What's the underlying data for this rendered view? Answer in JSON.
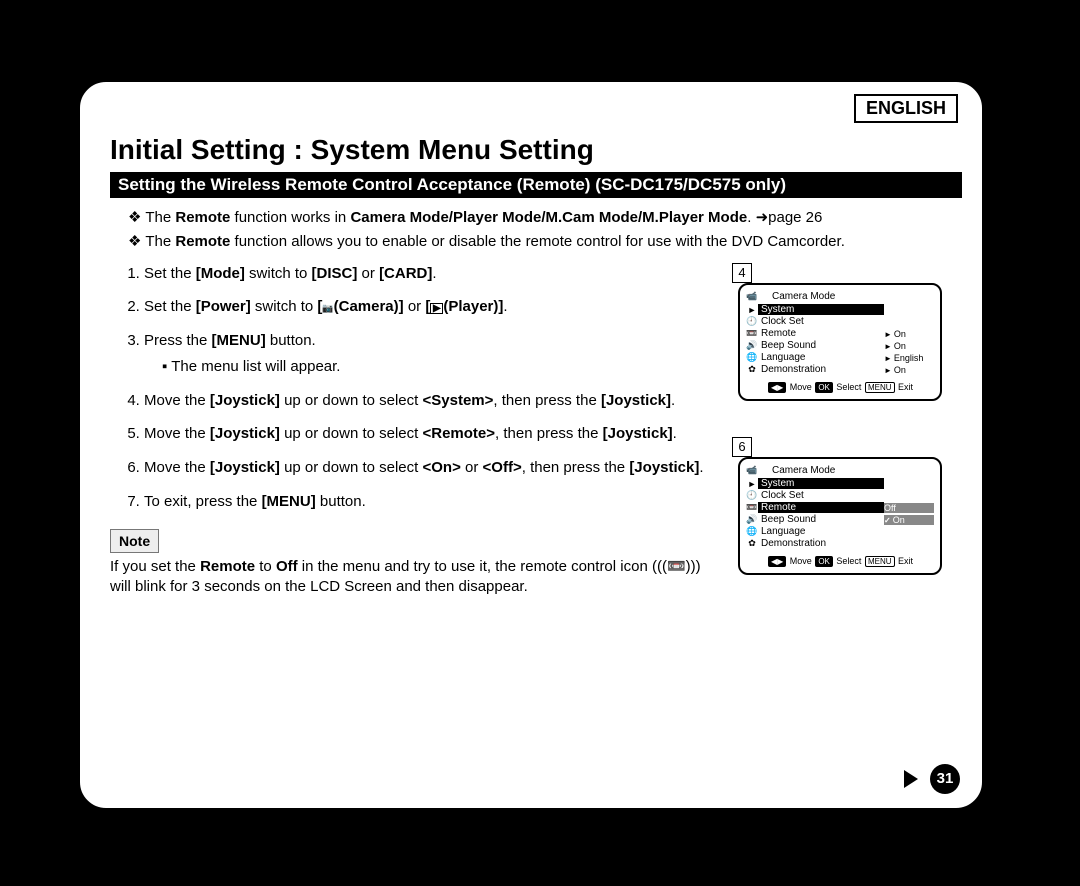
{
  "language_label": "ENGLISH",
  "title": "Initial Setting : System Menu Setting",
  "band": "Setting the Wireless Remote Control Acceptance (Remote) (SC-DC175/DC575 only)",
  "intro": {
    "l1a": "The ",
    "l1b": "Remote",
    "l1c": " function works in ",
    "l1d": "Camera Mode/Player Mode/M.Cam Mode/M.Player Mode",
    "l1e": ". ",
    "l1f": "page 26",
    "l2a": "The ",
    "l2b": "Remote",
    "l2c": " function allows you to enable or disable the remote control for use with the DVD Camcorder."
  },
  "steps": {
    "s1": {
      "a": "Set the ",
      "b": "[Mode]",
      "c": " switch to ",
      "d": "[DISC]",
      "e": " or ",
      "f": "[CARD]",
      "g": "."
    },
    "s2": {
      "a": "Set the ",
      "b": "[Power]",
      "c": " switch to ",
      "d": "[",
      "e": "(Camera)]",
      "f": " or ",
      "g": "[",
      "h": "(Player)]",
      "i": "."
    },
    "s3": {
      "a": "Press the ",
      "b": "[MENU]",
      "c": " button."
    },
    "s3sub": "The menu list will appear.",
    "s4": {
      "a": "Move the ",
      "b": "[Joystick]",
      "c": " up or down to select ",
      "d": "<System>",
      "e": ", then press the ",
      "f": "[Joystick]",
      "g": "."
    },
    "s5": {
      "a": "Move the ",
      "b": "[Joystick]",
      "c": " up or down to select ",
      "d": "<Remote>",
      "e": ", then press the ",
      "f": "[Joystick]",
      "g": "."
    },
    "s6": {
      "a": "Move the ",
      "b": "[Joystick]",
      "c": " up or down to select ",
      "d": "<On>",
      "e": " or ",
      "f": "<Off>",
      "g": ", then press the ",
      "h": "[Joystick]",
      "i": "."
    },
    "s7": {
      "a": "To exit, press the ",
      "b": "[MENU]",
      "c": " button."
    }
  },
  "note_label": "Note",
  "note": {
    "a": "If you set the ",
    "b": "Remote",
    "c": " to ",
    "d": "Off",
    "e": " in the menu and try to use it, the remote control icon (",
    "f": ") will blink for 3 seconds on the LCD Screen and then disappear."
  },
  "screens": {
    "s4": {
      "num": "4",
      "title": "Camera Mode",
      "rows": [
        {
          "icon": "►",
          "name": "System",
          "val": "",
          "hl": "hl"
        },
        {
          "icon": "🕘",
          "name": "Clock Set",
          "val": "",
          "hl": ""
        },
        {
          "icon": "📼",
          "name": "Remote",
          "val": "On",
          "valcls": "",
          "hl": ""
        },
        {
          "icon": "🔊",
          "name": "Beep Sound",
          "val": "On",
          "valcls": "",
          "hl": ""
        },
        {
          "icon": "🌐",
          "name": "Language",
          "val": "English",
          "valcls": "",
          "hl": ""
        },
        {
          "icon": "✿",
          "name": "Demonstration",
          "val": "On",
          "valcls": "",
          "hl": ""
        }
      ],
      "foot": {
        "move": "Move",
        "select": "Select",
        "exit": "Exit",
        "k1": "◀▶",
        "k2": "OK",
        "k3": "MENU"
      }
    },
    "s6": {
      "num": "6",
      "title": "Camera Mode",
      "rows": [
        {
          "icon": "►",
          "name": "System",
          "val": "",
          "hl": "hl"
        },
        {
          "icon": "🕘",
          "name": "Clock Set",
          "val": "",
          "hl": ""
        },
        {
          "icon": "📼",
          "name": "Remote",
          "val": "Off",
          "valcls": "none",
          "hl": "hl",
          "valhl": "hl-grey"
        },
        {
          "icon": "🔊",
          "name": "Beep Sound",
          "val": "On",
          "valcls": "check",
          "hl": "",
          "valhl": "hl-grey"
        },
        {
          "icon": "🌐",
          "name": "Language",
          "val": "",
          "hl": ""
        },
        {
          "icon": "✿",
          "name": "Demonstration",
          "val": "",
          "hl": ""
        }
      ],
      "foot": {
        "move": "Move",
        "select": "Select",
        "exit": "Exit",
        "k1": "◀▶",
        "k2": "OK",
        "k3": "MENU"
      }
    }
  },
  "page_number": "31"
}
